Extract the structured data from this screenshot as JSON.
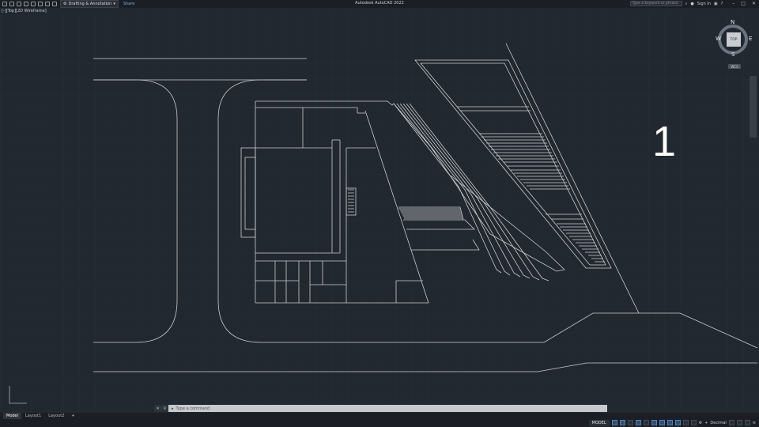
{
  "app": {
    "title": "Autodesk AutoCAD 2022"
  },
  "toolbar": {
    "workspace": "Drafting & Annotation",
    "share": "Share"
  },
  "search": {
    "placeholder": "Type a keyword or phrase"
  },
  "account": {
    "sign_in": "Sign In"
  },
  "viewport": {
    "label": "[-][Top][2D Wireframe]"
  },
  "drawing": {
    "sheet_number": "1"
  },
  "viewcube": {
    "face": "TOP",
    "north": "N",
    "south": "S",
    "east": "E",
    "west": "W",
    "wcs": "WCS"
  },
  "command": {
    "placeholder": "Type a command"
  },
  "layout_tabs": [
    "Model",
    "Layout1",
    "Layout2"
  ],
  "status": {
    "space": "MODEL",
    "units": "Decimal"
  },
  "colors": {
    "background": "#212830",
    "linework": "#c9ccd0",
    "accent": "#4f82b7"
  }
}
